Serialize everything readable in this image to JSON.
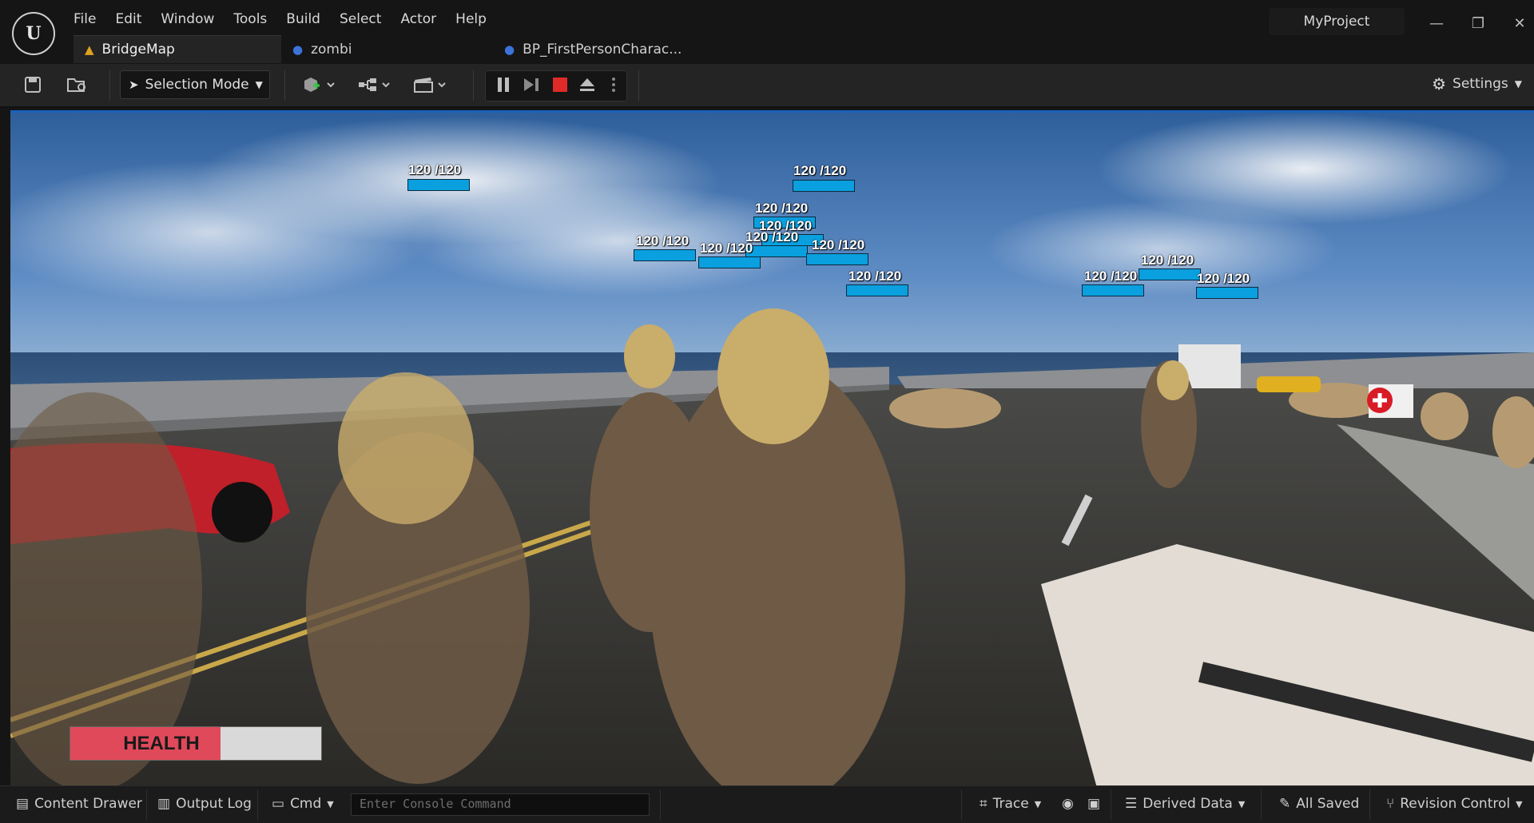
{
  "app": {
    "logo_glyph": "U",
    "menu": [
      "File",
      "Edit",
      "Window",
      "Tools",
      "Build",
      "Select",
      "Actor",
      "Help"
    ],
    "project_name": "MyProject",
    "window_controls": {
      "minimize": "—",
      "restore": "❐",
      "close": "✕"
    }
  },
  "tabs": [
    {
      "label": "BridgeMap",
      "icon": "level-icon",
      "active": true
    },
    {
      "label": "zombi",
      "icon": "blueprint-icon",
      "active": false
    },
    {
      "label": "BP_FirstPersonCharac...",
      "icon": "blueprint-icon",
      "active": false
    }
  ],
  "toolbar": {
    "mode_label": "Selection Mode",
    "settings_label": "Settings",
    "icons": [
      "save-icon",
      "browse-icon",
      "add-actor-icon",
      "blueprint-graph-icon",
      "cinematics-icon",
      "pause-icon",
      "step-icon",
      "stop-icon",
      "eject-icon",
      "more-options-icon"
    ]
  },
  "game": {
    "health_label": "HEALTH",
    "health_fraction": 0.6,
    "health_colors": {
      "fill": "#e0495a",
      "empty": "#d9d9d9"
    },
    "enemy_health_text": [
      "120 /120",
      "120 /120",
      "120 /120",
      "120 /120",
      "120 /120",
      "120 /120",
      "120 /120",
      "120 /120",
      "120 /120",
      "120 /120",
      "120 /120",
      "120 /120"
    ],
    "health_bar_color": "#0aa0df"
  },
  "statusbar": {
    "content_drawer": "Content Drawer",
    "output_log": "Output Log",
    "cmd": "Cmd",
    "console_placeholder": "Enter Console Command",
    "trace": "Trace",
    "derived_data": "Derived Data",
    "all_saved": "All Saved",
    "revision_control": "Revision Control"
  },
  "colors": {
    "viewport_border": "#1b62b8",
    "stop_button": "#e02a2a"
  }
}
